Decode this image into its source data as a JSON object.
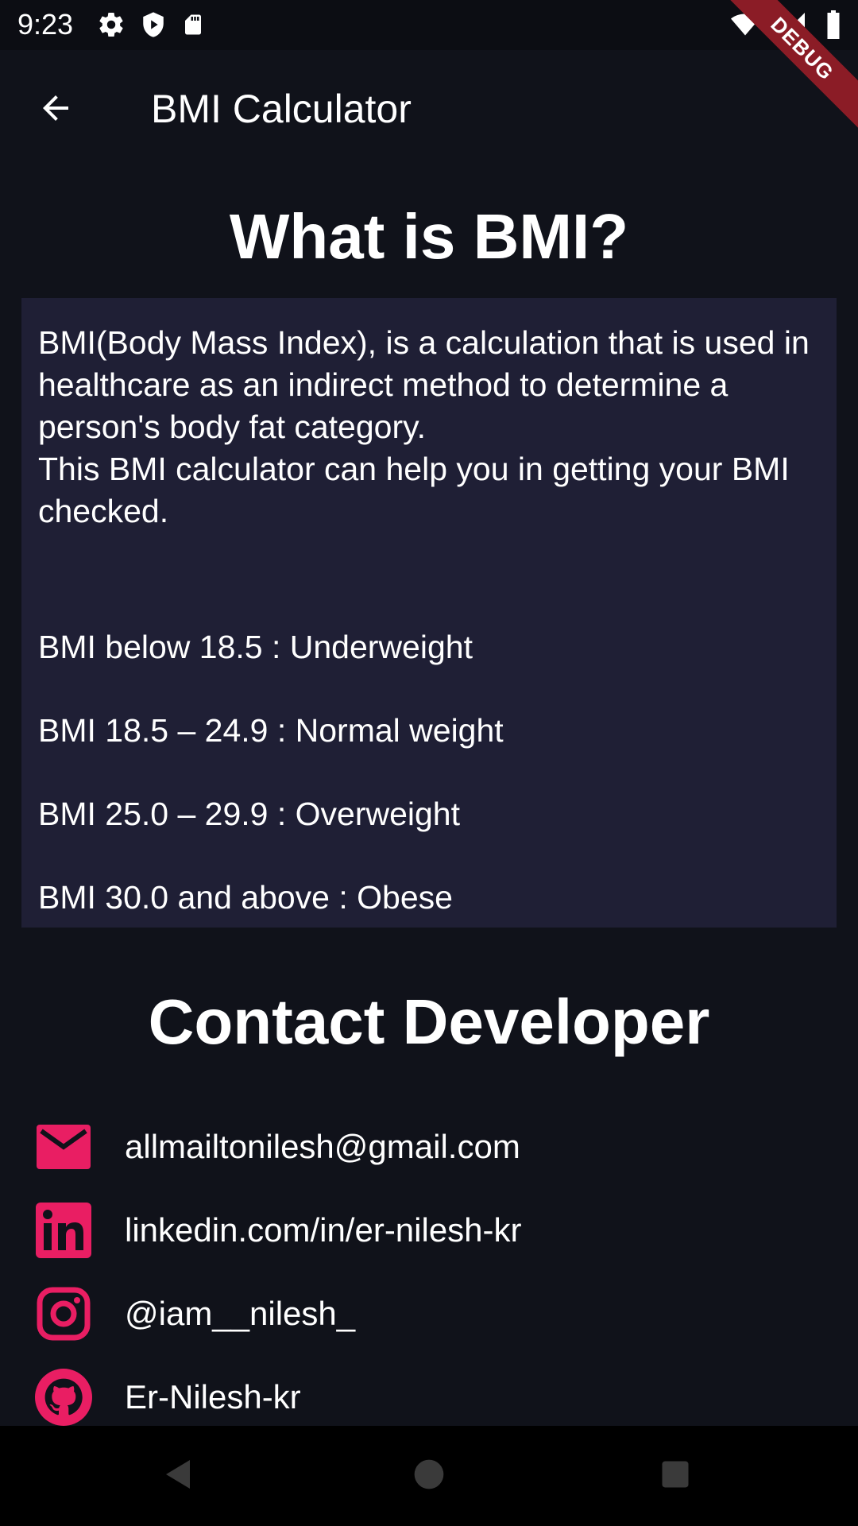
{
  "status_bar": {
    "time": "9:23",
    "icons_left": [
      "gear-icon",
      "shield-play-icon",
      "sd-card-icon"
    ],
    "icons_right": [
      "wifi-icon",
      "signal-icon",
      "battery-icon"
    ]
  },
  "debug_banner": "DEBUG",
  "app_bar": {
    "back_icon": "arrow-back-icon",
    "title": "BMI Calculator"
  },
  "bmi_section": {
    "heading": "What is BMI?",
    "description_line1": "BMI(Body Mass Index), is a calculation that is used in healthcare as an indirect method to determine a person's body fat category.",
    "description_line2": "This BMI calculator can help you in getting your BMI checked.",
    "ranges": [
      {
        "text": "BMI below 18.5 :  Underweight"
      },
      {
        "text": "BMI 18.5 – 24.9 :  Normal weight"
      },
      {
        "text": "BMI 25.0 – 29.9 :  Overweight"
      },
      {
        "text": "BMI 30.0 and above :  Obese"
      }
    ]
  },
  "contact_section": {
    "heading": "Contact Developer",
    "items": [
      {
        "icon": "email-icon",
        "text": "allmailtonilesh@gmail.com"
      },
      {
        "icon": "linkedin-icon",
        "text": "linkedin.com/in/er-nilesh-kr"
      },
      {
        "icon": "instagram-icon",
        "text": "@iam__nilesh_"
      },
      {
        "icon": "github-icon",
        "text": "Er-Nilesh-kr"
      }
    ]
  },
  "colors": {
    "background": "#10121a",
    "card": "#1f1f35",
    "accent": "#e91e63",
    "debug_ribbon": "#8b1c26"
  },
  "nav_bar": {
    "buttons": [
      "back-triangle-icon",
      "home-circle-icon",
      "recents-square-icon"
    ]
  }
}
